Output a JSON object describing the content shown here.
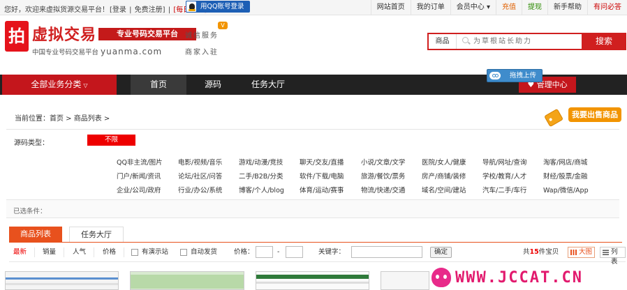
{
  "topbar": {
    "welcome": "您好，欢迎来虚拟货源交易平台！",
    "login": "[登录",
    "sep": "|",
    "register": "免费注册]",
    "signin": "[每日签到]",
    "qq_login": "用QQ账号登录",
    "nav": [
      "网站首页",
      "我的订单",
      "会员中心 ▾",
      "充值",
      "提现",
      "新手帮助",
      "有问必答"
    ]
  },
  "logo": {
    "char": "拍",
    "title": "虚拟交易",
    "tagline": "专业号码交易平台",
    "sub": "中国专业号码交易平台",
    "domain": "yuanma.com",
    "integrity": "诚信服务",
    "merchant": "商家入驻",
    "badge": "V"
  },
  "search": {
    "category": "商品",
    "placeholder": "为草根站长助力",
    "button": "搜索"
  },
  "navbar": {
    "all_categories": "全部业务分类",
    "items": [
      "首页",
      "源码",
      "任务大厅"
    ],
    "manage": "♥ 管理中心",
    "upload": "拖拽上传"
  },
  "crumb": "当前位置：首页 > 商品列表 >",
  "sell_button": "我要出售商品",
  "filter": {
    "label": "源码类型：",
    "no_limit": "不限",
    "options": [
      [
        "QQ非主流/图片",
        "电影/视频/音乐",
        "游戏/动漫/竞技",
        "聊天/交友/直播",
        "小说/文章/文学",
        "医院/女人/健康",
        "导航/网址/查询",
        "淘客/网店/商城"
      ],
      [
        "门户/新闻/资讯",
        "论坛/社区/问答",
        "二手/B2B/分类",
        "软件/下载/电脑",
        "旅游/餐饮/票务",
        "房产/商铺/装修",
        "学校/教育/人才",
        "财经/股票/金融"
      ],
      [
        "企业/公司/政府",
        "行业/办公/系统",
        "博客/个人/blog",
        "体育/运动/赛事",
        "物流/快递/交通",
        "域名/空间/建站",
        "汽车/二手/车行",
        "Wap/微信/App"
      ]
    ]
  },
  "selected_label": "已选条件：",
  "tabs": [
    "商品列表",
    "任务大厅"
  ],
  "sort": {
    "options": [
      "最新",
      "销量",
      "人气",
      "价格"
    ],
    "has_demo": "有演示站",
    "auto_ship": "自动发货",
    "price_label": "价格：",
    "dash": "-",
    "keyword_label": "关键字：",
    "confirm": "确定",
    "count_prefix": "共",
    "count": "15",
    "count_suffix": "件宝贝",
    "view_large": "大图",
    "view_list": "列表"
  },
  "watermark": "WWW.JCCAT.CN",
  "colors": {
    "brand_red": "#d01f1f",
    "nav_dark": "#222222",
    "tab_orange": "#e8511d",
    "sell_orange": "#f29400",
    "watermark_pink": "#e21a6e"
  }
}
